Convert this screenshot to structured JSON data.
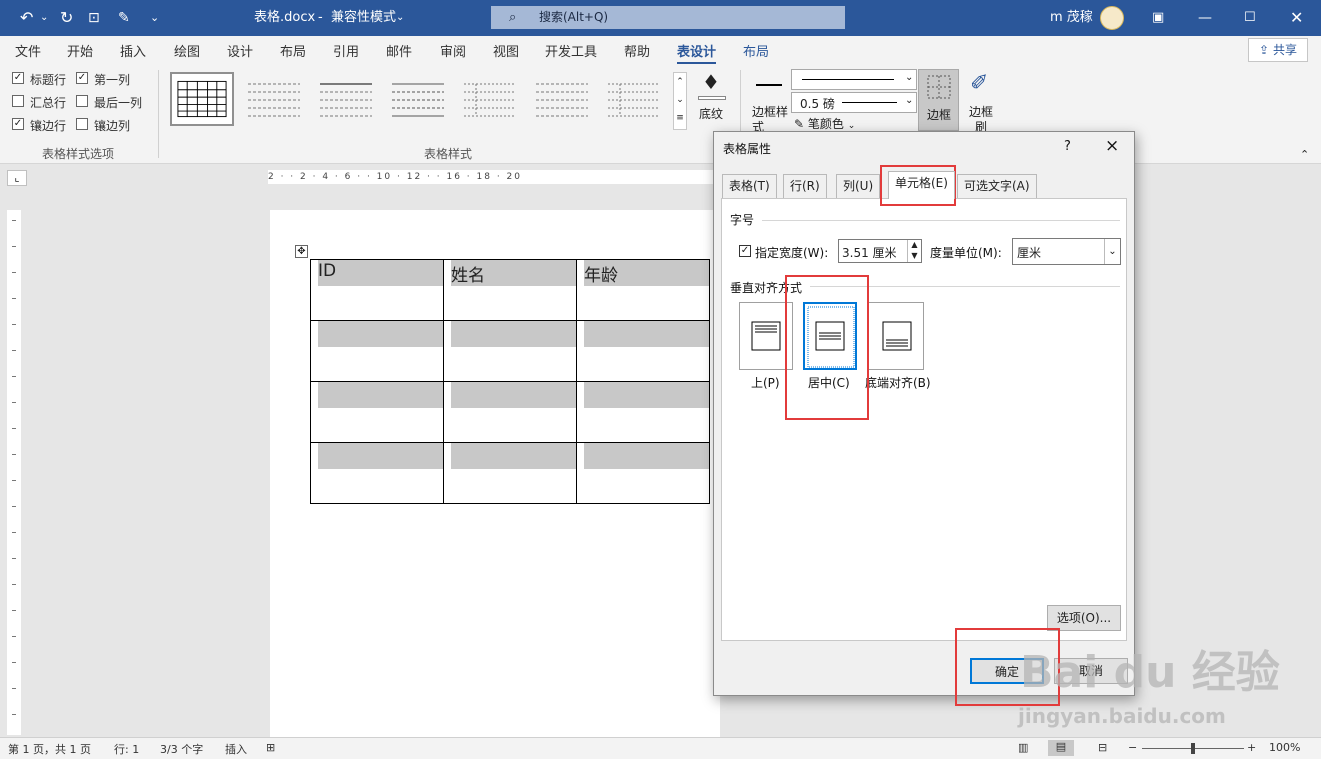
{
  "titlebar": {
    "filename": "表格.docx",
    "separator": "-",
    "mode": "兼容性模式",
    "search_placeholder": "搜索(Alt+Q)",
    "user": "m 茂稼",
    "icons": [
      "undo-icon",
      "redo-icon",
      "touch-mode-icon",
      "new-doc-icon",
      "qat-more-icon",
      "ribbon-display-icon",
      "minimize-icon",
      "maximize-icon",
      "close-icon"
    ]
  },
  "menu_tabs": [
    "文件",
    "开始",
    "插入",
    "绘图",
    "设计",
    "布局",
    "引用",
    "邮件",
    "审阅",
    "视图",
    "开发工具",
    "帮助",
    "表设计",
    "布局"
  ],
  "active_tab": "表设计",
  "share_label": "共享",
  "ribbon": {
    "style_options": {
      "items": [
        {
          "label": "标题行",
          "checked": true
        },
        {
          "label": "第一列",
          "checked": true
        },
        {
          "label": "汇总行",
          "checked": false
        },
        {
          "label": "最后一列",
          "checked": false
        },
        {
          "label": "镶边行",
          "checked": true
        },
        {
          "label": "镶边列",
          "checked": false
        }
      ],
      "group_label": "表格样式选项"
    },
    "styles_group_label": "表格样式",
    "shading_label": "底纹",
    "border_styles_label": "边框样式",
    "border_weight": "0.5 磅",
    "pen_color_label": "笔颜色",
    "borders_label": "边框",
    "border_painter_label": "边框刷"
  },
  "ruler_text": "2 · · 2 · 4 · 6 · · 10 · 12 · · 16 · 18 · 20",
  "document_table": {
    "headers": [
      "ID",
      "姓名",
      "年龄"
    ],
    "rows": 4
  },
  "dialog": {
    "title": "表格属性",
    "help": "?",
    "close": "×",
    "tabs": [
      "表格(T)",
      "行(R)",
      "列(U)",
      "单元格(E)",
      "可选文字(A)"
    ],
    "active_tab": "单元格(E)",
    "size_section": "字号",
    "specify_width_label": "指定宽度(W):",
    "specify_width_checked": true,
    "width_value": "3.51 厘米",
    "measure_label": "度量单位(M):",
    "measure_value": "厘米",
    "valign_section": "垂直对齐方式",
    "valign_options": [
      "上(P)",
      "居中(C)",
      "底端对齐(B)"
    ],
    "valign_selected": "居中(C)",
    "options_button": "选项(O)...",
    "ok_button": "确定",
    "cancel_button": "取消"
  },
  "statusbar": {
    "page": "第 1 页，共 1 页",
    "line": "行: 1",
    "words": "3/3 个字",
    "insert_mode": "插入",
    "zoom": "100%",
    "zoom_level": 0.5
  },
  "watermark": {
    "brand": "Bai du 经验",
    "url": "jingyan.baidu.com"
  },
  "colors": {
    "titlebar": "#2b579a",
    "accent": "#2b579a",
    "highlight": "#e23b3b",
    "selection": "#0078d7"
  }
}
